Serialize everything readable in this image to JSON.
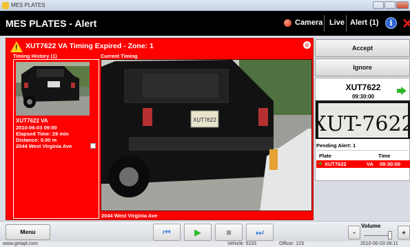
{
  "window": {
    "title": "MES PLATES"
  },
  "appbar": {
    "title": "MES PLATES - Alert",
    "camera": "Camera",
    "live": "Live",
    "alert": "Alert (1)"
  },
  "alert_header": {
    "text": "XUT7622   VA   Timing Expired - Zone: 1"
  },
  "labels": {
    "history": "Timing History (1)",
    "current": "Current Timing"
  },
  "history": {
    "plate_state": "XUT7622   VA",
    "datetime": "2010-06-03 09:00",
    "elapsed": "Elapsed Time: 29 min",
    "distance": "Distance: 0.00 m",
    "address": "2044 West Virginia Ave"
  },
  "image_caption": "2044 West Virginia Ave",
  "right": {
    "accept": "Accept",
    "ignore": "Ignore",
    "plate": "XUT7622",
    "time": "09:30:00",
    "plate_image_text": "XUT-7622",
    "pending": "Pending Alert: 1",
    "table": {
      "headers": [
        "Plate",
        "Time"
      ],
      "rows": [
        {
          "plate": "XUT7622",
          "state": "VA",
          "time": "09:30:00"
        }
      ]
    }
  },
  "bottom": {
    "menu": "Menu",
    "volume": "Volume",
    "minus": "-",
    "plus": "+"
  },
  "status": {
    "website": "www.getapl.com",
    "vehicle": "Vehicle: 5233",
    "officer": "Officer: 123",
    "datetime": "2010-06-03 09:11"
  },
  "colors": {
    "alert_red": "#ff0000",
    "play_green": "#2fb82a",
    "skip_blue": "#4a87d8"
  }
}
